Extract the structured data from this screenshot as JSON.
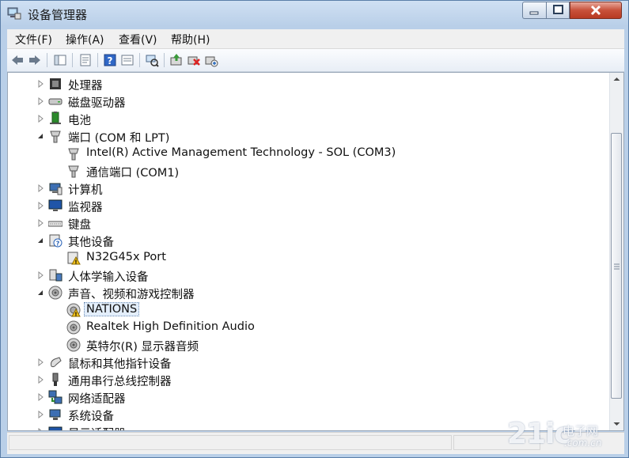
{
  "window": {
    "title": "设备管理器"
  },
  "menu": {
    "items": [
      "文件(F)",
      "操作(A)",
      "查看(V)",
      "帮助(H)"
    ]
  },
  "toolbar": {
    "icons": [
      "back-arrow-icon",
      "forward-arrow-icon",
      "show-hide-tree-icon",
      "properties-icon",
      "help-icon",
      "view-icon",
      "scan-hardware-icon",
      "update-driver-icon",
      "uninstall-icon",
      "enable-device-icon"
    ]
  },
  "tree": {
    "rows": [
      {
        "label": "处理器",
        "level": 0,
        "state": "collapsed",
        "icon": "processor-icon"
      },
      {
        "label": "磁盘驱动器",
        "level": 0,
        "state": "collapsed",
        "icon": "disk-drive-icon"
      },
      {
        "label": "电池",
        "level": 0,
        "state": "collapsed",
        "icon": "battery-icon"
      },
      {
        "label": "端口 (COM 和 LPT)",
        "level": 0,
        "state": "expanded",
        "icon": "port-icon"
      },
      {
        "label": "Intel(R) Active Management Technology - SOL (COM3)",
        "level": 1,
        "icon": "port-icon"
      },
      {
        "label": "通信端口 (COM1)",
        "level": 1,
        "icon": "port-icon"
      },
      {
        "label": "计算机",
        "level": 0,
        "state": "collapsed",
        "icon": "computer-icon"
      },
      {
        "label": "监视器",
        "level": 0,
        "state": "collapsed",
        "icon": "monitor-icon"
      },
      {
        "label": "键盘",
        "level": 0,
        "state": "collapsed",
        "icon": "keyboard-icon"
      },
      {
        "label": "其他设备",
        "level": 0,
        "state": "expanded",
        "icon": "unknown-device-icon"
      },
      {
        "label": "N32G45x Port",
        "level": 1,
        "icon": "warning-device-icon"
      },
      {
        "label": "人体学输入设备",
        "level": 0,
        "state": "collapsed",
        "icon": "hid-icon"
      },
      {
        "label": "声音、视频和游戏控制器",
        "level": 0,
        "state": "expanded",
        "icon": "speaker-icon"
      },
      {
        "label": "NATIONS",
        "level": 1,
        "icon": "warning-speaker-icon",
        "selected": true
      },
      {
        "label": "Realtek High Definition Audio",
        "level": 1,
        "icon": "speaker-icon"
      },
      {
        "label": "英特尔(R) 显示器音频",
        "level": 1,
        "icon": "speaker-icon"
      },
      {
        "label": "鼠标和其他指针设备",
        "level": 0,
        "state": "collapsed",
        "icon": "mouse-icon"
      },
      {
        "label": "通用串行总线控制器",
        "level": 0,
        "state": "collapsed",
        "icon": "usb-icon"
      },
      {
        "label": "网络适配器",
        "level": 0,
        "state": "collapsed",
        "icon": "network-icon"
      },
      {
        "label": "系统设备",
        "level": 0,
        "state": "collapsed",
        "icon": "system-icon"
      },
      {
        "label": "显示适配器",
        "level": 0,
        "state": "collapsed",
        "icon": "display-icon"
      }
    ]
  },
  "watermark": {
    "brand": "21ic",
    "cn": "电子网",
    "domain": ".com.cn"
  },
  "colors": {
    "selection": "#e3eefb",
    "titlebar": "#b9cfe8",
    "close": "#c8513a"
  }
}
